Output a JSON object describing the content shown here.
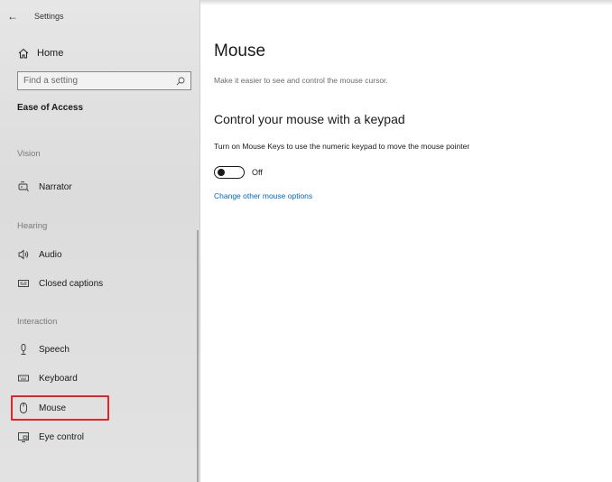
{
  "window": {
    "title": "Settings"
  },
  "sidebar": {
    "home_label": "Home",
    "search_placeholder": "Find a setting",
    "section_title": "Ease of Access",
    "groups": {
      "vision": "Vision",
      "hearing": "Hearing",
      "interaction": "Interaction"
    },
    "items": [
      {
        "label": "Narrator",
        "icon": "narrator-icon"
      },
      {
        "label": "Audio",
        "icon": "audio-icon"
      },
      {
        "label": "Closed captions",
        "icon": "closed-captions-icon"
      },
      {
        "label": "Speech",
        "icon": "microphone-icon"
      },
      {
        "label": "Keyboard",
        "icon": "keyboard-icon"
      },
      {
        "label": "Mouse",
        "icon": "mouse-icon",
        "selected": true
      },
      {
        "label": "Eye control",
        "icon": "eye-control-icon"
      }
    ]
  },
  "main": {
    "title": "Mouse",
    "subtitle": "Make it easier to see and control the mouse cursor.",
    "section_heading": "Control your mouse with a keypad",
    "description": "Turn on Mouse Keys to use the numeric keypad to move the mouse pointer",
    "toggle_state": "Off",
    "link_text": "Change other mouse options"
  },
  "colors": {
    "accent_link": "#0067c0",
    "highlight_outline": "#e0262b"
  }
}
